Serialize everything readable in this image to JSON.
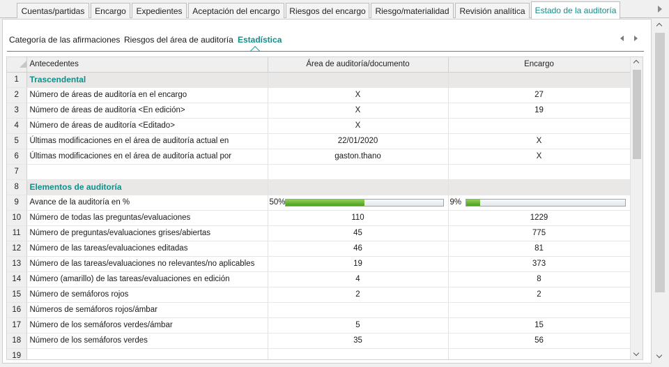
{
  "top_tabs": [
    {
      "label": "Cuentas/partidas"
    },
    {
      "label": "Encargo"
    },
    {
      "label": "Expedientes"
    },
    {
      "label": "Aceptación del encargo"
    },
    {
      "label": "Riesgos del encargo"
    },
    {
      "label": "Riesgo/materialidad"
    },
    {
      "label": "Revisión analítica"
    },
    {
      "label": "Estado de la auditoría"
    }
  ],
  "sub_tabs": [
    {
      "label": "Categoría de las afirmaciones"
    },
    {
      "label": "Riesgos del área de auditoría"
    },
    {
      "label": "Estadística"
    }
  ],
  "table": {
    "headers": {
      "description": "Antecedentes",
      "area": "Área de auditoría/documento",
      "engagement": "Encargo"
    },
    "rows": [
      {
        "num": "1",
        "desc": "Trascendental",
        "area": "",
        "engagement": "",
        "section": true
      },
      {
        "num": "2",
        "desc": "Número de áreas de auditoría en el encargo",
        "area": "X",
        "engagement": "27"
      },
      {
        "num": "3",
        "desc": "Número de áreas de auditoría <En edición>",
        "area": "X",
        "engagement": "19"
      },
      {
        "num": "4",
        "desc": "Número de áreas de auditoría <Editado>",
        "area": "X",
        "engagement": ""
      },
      {
        "num": "5",
        "desc": "Últimas modificaciones en el área de auditoría actual en",
        "area": "22/01/2020",
        "engagement": "X"
      },
      {
        "num": "6",
        "desc": "Últimas modificaciones en el área de auditoría actual por",
        "area": "gaston.thano",
        "engagement": "X"
      },
      {
        "num": "7",
        "desc": "",
        "area": "",
        "engagement": ""
      },
      {
        "num": "8",
        "desc": "Elementos de auditoría",
        "area": "",
        "engagement": "",
        "section": true
      },
      {
        "num": "9",
        "desc": "Avance de la auditoría en %",
        "progress": true,
        "area": "50%",
        "area_fraction": 0.5,
        "engagement": "9%",
        "engagement_fraction": 0.09
      },
      {
        "num": "10",
        "desc": "Número de todas las preguntas/evaluaciones",
        "area": "110",
        "engagement": "1229"
      },
      {
        "num": "11",
        "desc": "Número de preguntas/evaluaciones grises/abiertas",
        "area": "45",
        "engagement": "775"
      },
      {
        "num": "12",
        "desc": "Número de las tareas/evaluaciones editadas",
        "area": "46",
        "engagement": "81"
      },
      {
        "num": "13",
        "desc": "Número de las tareas/evaluaciones no relevantes/no aplicables",
        "area": "19",
        "engagement": "373"
      },
      {
        "num": "14",
        "desc": "Número (amarillo) de las tareas/evaluaciones en edición",
        "area": "4",
        "engagement": "8"
      },
      {
        "num": "15",
        "desc": "Número de semáforos rojos",
        "area": "2",
        "engagement": "2"
      },
      {
        "num": "16",
        "desc": "Números de semáforos rojos/ámbar",
        "area": "",
        "engagement": ""
      },
      {
        "num": "17",
        "desc": "Número de los semáforos verdes/ámbar",
        "area": "5",
        "engagement": "15"
      },
      {
        "num": "18",
        "desc": "Número de los semáforos verdes",
        "area": "35",
        "engagement": "56"
      },
      {
        "num": "19",
        "desc": "",
        "area": "",
        "engagement": ""
      }
    ]
  },
  "colors": {
    "accent": "#0f8f8a",
    "section_bg": "#e9e8e6",
    "progress_fill": "#5aa828"
  }
}
